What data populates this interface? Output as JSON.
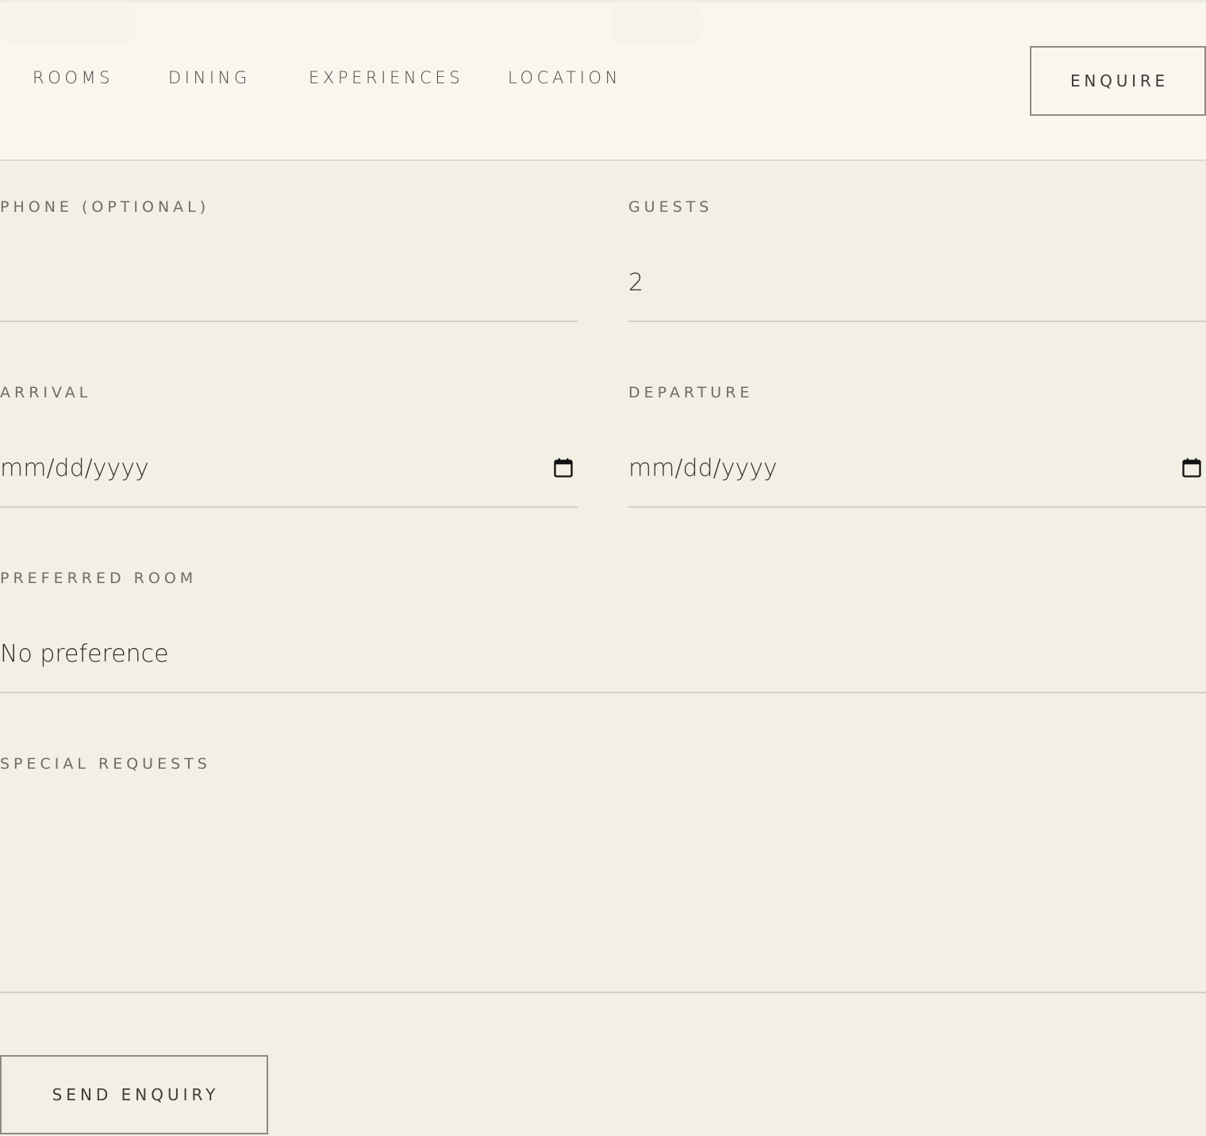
{
  "nav": {
    "items": [
      {
        "label": "ROOMS"
      },
      {
        "label": "DINING"
      },
      {
        "label": "EXPERIENCES"
      },
      {
        "label": "LOCATION"
      }
    ],
    "enquire_label": "ENQUIRE"
  },
  "form": {
    "phone": {
      "label": "PHONE (OPTIONAL)",
      "value": ""
    },
    "guests": {
      "label": "GUESTS",
      "value": "2"
    },
    "arrival": {
      "label": "ARRIVAL",
      "placeholder": "mm/dd/yyyy",
      "icon": "calendar-icon"
    },
    "departure": {
      "label": "DEPARTURE",
      "placeholder": "mm/dd/yyyy",
      "icon": "calendar-icon"
    },
    "preferred_room": {
      "label": "PREFERRED ROOM",
      "value": "No preference"
    },
    "special_requests": {
      "label": "SPECIAL REQUESTS",
      "value": ""
    },
    "submit_label": "SEND ENQUIRY"
  },
  "colors": {
    "background": "#f2efe4",
    "header": "#f8f6ef",
    "border": "#8f8b82",
    "divider": "#d4d0c5",
    "label": "#6f6c64",
    "text": "#2f2d29"
  }
}
